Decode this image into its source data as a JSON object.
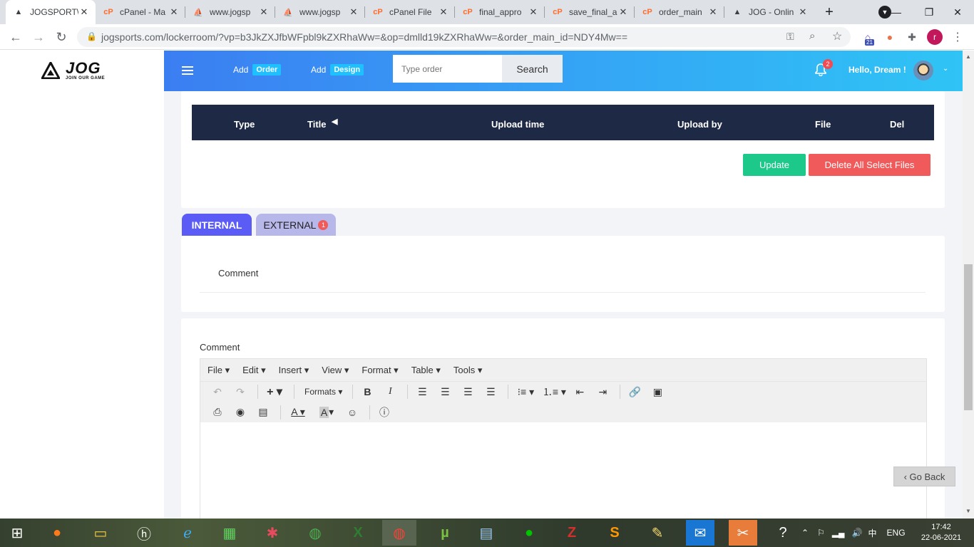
{
  "browser": {
    "tabs": [
      {
        "title": "JOGSPORT\\",
        "icon": "jog-logo-icon",
        "active": true
      },
      {
        "title": "cPanel - Ma",
        "icon": "cpanel-icon"
      },
      {
        "title": "www.jogsp",
        "icon": "phpmyadmin-icon"
      },
      {
        "title": "www.jogsp",
        "icon": "phpmyadmin-icon"
      },
      {
        "title": "cPanel File",
        "icon": "cpanel-icon"
      },
      {
        "title": "final_appro",
        "icon": "cpanel-icon"
      },
      {
        "title": "save_final_a",
        "icon": "cpanel-icon"
      },
      {
        "title": "order_main",
        "icon": "cpanel-icon"
      },
      {
        "title": "JOG - Onlin",
        "icon": "jog-logo-icon"
      }
    ],
    "url": "jogsports.com/lockerroom/?vp=b3JkZXJfbWFpbl9kZXRhaWw=&op=dmlld19kZXRhaWw=&order_main_id=NDY4Mw==",
    "ext_badge": "21",
    "profile_initial": "r"
  },
  "logo": {
    "brand": "JOG",
    "tagline": "JOIN OUR GAME"
  },
  "header": {
    "add_prefix": "Add",
    "add_order": "Order",
    "add_design": "Design",
    "search_placeholder": "Type order",
    "search_button": "Search",
    "notification_count": "2",
    "greeting": "Hello, Dream !"
  },
  "file_table": {
    "columns": [
      "Type",
      "Title",
      "Upload time",
      "Upload by",
      "File",
      "Del"
    ],
    "title_sort_icon": "caret-left-icon"
  },
  "actions": {
    "update": "Update",
    "delete_all": "Delete All Select Files"
  },
  "tabs": {
    "internal": "INTERNAL",
    "external": "EXTERNAL",
    "external_count": "1"
  },
  "comments": {
    "heading": "Comment",
    "editor_label": "Comment"
  },
  "editor": {
    "menu": [
      "File",
      "Edit",
      "Insert",
      "View",
      "Format",
      "Table",
      "Tools"
    ],
    "formats_label": "Formats"
  },
  "go_back": "‹ Go Back",
  "taskbar": {
    "lang": "ENG",
    "time": "17:42",
    "date": "22-06-2021"
  },
  "colors": {
    "header_start": "#3b7ef2",
    "header_end": "#2fc4f5",
    "update": "#1cc88a",
    "delete": "#f05a5a",
    "internal_tab": "#5a5cf5",
    "table_header": "#1e2a45"
  }
}
